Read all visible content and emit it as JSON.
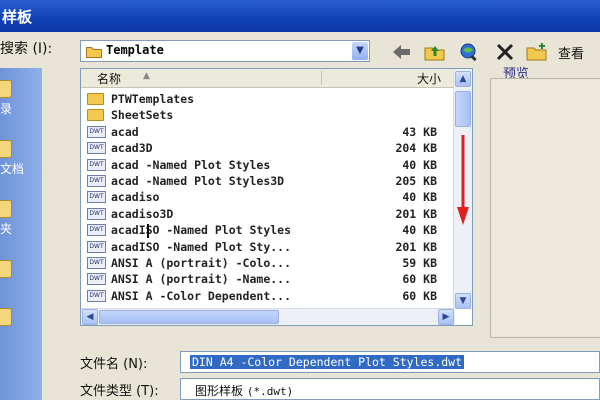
{
  "window": {
    "title": "样板"
  },
  "toolbar": {
    "lookin_label": "搜索 (I):",
    "current_folder": "Template",
    "view_label": "查看"
  },
  "places": [
    "录",
    "文档",
    "夹",
    "",
    ""
  ],
  "file_list": {
    "name_header": "名称",
    "size_header": "大小",
    "rows": [
      {
        "name": "PTWTemplates",
        "size": "",
        "type": "folder"
      },
      {
        "name": "SheetSets",
        "size": "",
        "type": "folder"
      },
      {
        "name": "acad",
        "size": "43 KB",
        "type": "dwt"
      },
      {
        "name": "acad3D",
        "size": "204 KB",
        "type": "dwt"
      },
      {
        "name": "acad -Named Plot Styles",
        "size": "40 KB",
        "type": "dwt"
      },
      {
        "name": "acad -Named Plot Styles3D",
        "size": "205 KB",
        "type": "dwt"
      },
      {
        "name": "acadiso",
        "size": "40 KB",
        "type": "dwt"
      },
      {
        "name": "acadiso3D",
        "size": "201 KB",
        "type": "dwt"
      },
      {
        "name": "acadISO -Named Plot Styles",
        "size": "40 KB",
        "type": "dwt"
      },
      {
        "name": "acadISO -Named Plot Sty...",
        "size": "201 KB",
        "type": "dwt"
      },
      {
        "name": "ANSI A (portrait) -Colo...",
        "size": "59 KB",
        "type": "dwt"
      },
      {
        "name": "ANSI A (portrait) -Name...",
        "size": "60 KB",
        "type": "dwt"
      },
      {
        "name": "ANSI A -Color Dependent...",
        "size": "60 KB",
        "type": "dwt"
      }
    ]
  },
  "preview": {
    "label": "预览"
  },
  "filename": {
    "label": "文件名 (N):",
    "value": "DIN A4 -Color Dependent Plot Styles.dwt"
  },
  "filetype": {
    "label": "文件类型 (T):",
    "value": "图形样板",
    "ext": "(*.dwt)"
  },
  "icons": {
    "back": "back-arrow-icon",
    "up": "up-folder-icon",
    "search": "search-web-icon",
    "delete": "delete-icon",
    "new_folder": "new-folder-icon",
    "folder": "folder-icon",
    "dwt_file": "dwt-file-icon"
  },
  "colors": {
    "title_bar": "#1140b6",
    "selection": "#316ac5",
    "annotation_arrow": "#e02020"
  }
}
